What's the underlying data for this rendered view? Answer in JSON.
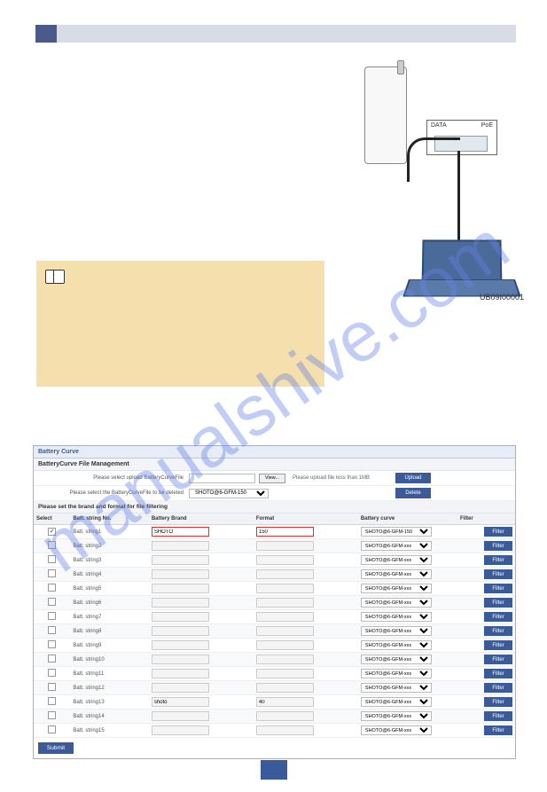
{
  "watermark": "manualshive.com",
  "diagram": {
    "port_label_left": "DATA",
    "port_label_right": "PoE",
    "id": "UB09I00001"
  },
  "panel": {
    "title": "Battery Curve",
    "section_title": "BatteryCurve File Management",
    "upload_row": {
      "label": "Please select upload BatteryCurveFile",
      "browse": "View...",
      "hint": "Please upload file less than 1MB",
      "button": "Upload"
    },
    "delete_row": {
      "label": "Please select the BatteryCurveFile to be deleted",
      "select_value": "SHOTO@6-GFM-150",
      "button": "Delete"
    },
    "filter_note": "Please set the brand and format for file filtering",
    "headers": {
      "select": "Select",
      "no": "Batt. string No.",
      "brand": "Battery Brand",
      "format": "Format",
      "curve": "Battery curve",
      "filter": "Filter"
    },
    "filter_button": "Filter",
    "submit": "Submit",
    "rows": [
      {
        "no": "Batt. string1",
        "checked": true,
        "brand": "SHOTO",
        "format": "150",
        "curve": "SHOTO@6-GFM-150",
        "highlight": true
      },
      {
        "no": "Batt. string2",
        "checked": false,
        "brand": "",
        "format": "",
        "curve": "SHOTO@6-GFM-xxx"
      },
      {
        "no": "Batt. string3",
        "checked": false,
        "brand": "",
        "format": "",
        "curve": "SHOTO@6-GFM-xxx"
      },
      {
        "no": "Batt. string4",
        "checked": false,
        "brand": "",
        "format": "",
        "curve": "SHOTO@6-GFM-xxx"
      },
      {
        "no": "Batt. string5",
        "checked": false,
        "brand": "",
        "format": "",
        "curve": "SHOTO@6-GFM-xxx"
      },
      {
        "no": "Batt. string6",
        "checked": false,
        "brand": "",
        "format": "",
        "curve": "SHOTO@6-GFM-xxx"
      },
      {
        "no": "Batt. string7",
        "checked": false,
        "brand": "",
        "format": "",
        "curve": "SHOTO@6-GFM-xxx"
      },
      {
        "no": "Batt. string8",
        "checked": false,
        "brand": "",
        "format": "",
        "curve": "SHOTO@6-GFM-xxx"
      },
      {
        "no": "Batt. string9",
        "checked": false,
        "brand": "",
        "format": "",
        "curve": "SHOTO@6-GFM-xxx"
      },
      {
        "no": "Batt. string10",
        "checked": false,
        "brand": "",
        "format": "",
        "curve": "SHOTO@6-GFM-xxx"
      },
      {
        "no": "Batt. string11",
        "checked": false,
        "brand": "",
        "format": "",
        "curve": "SHOTO@6-GFM-xxx"
      },
      {
        "no": "Batt. string12",
        "checked": false,
        "brand": "",
        "format": "",
        "curve": "SHOTO@6-GFM-xxx"
      },
      {
        "no": "Batt. string13",
        "checked": false,
        "brand": "shoto",
        "format": "40",
        "curve": "SHOTO@6-GFM-xxx"
      },
      {
        "no": "Batt. string14",
        "checked": false,
        "brand": "",
        "format": "",
        "curve": "SHOTO@6-GFM-xxx"
      },
      {
        "no": "Batt. string15",
        "checked": false,
        "brand": "",
        "format": "",
        "curve": "SHOTO@6-GFM-xxx"
      }
    ]
  }
}
